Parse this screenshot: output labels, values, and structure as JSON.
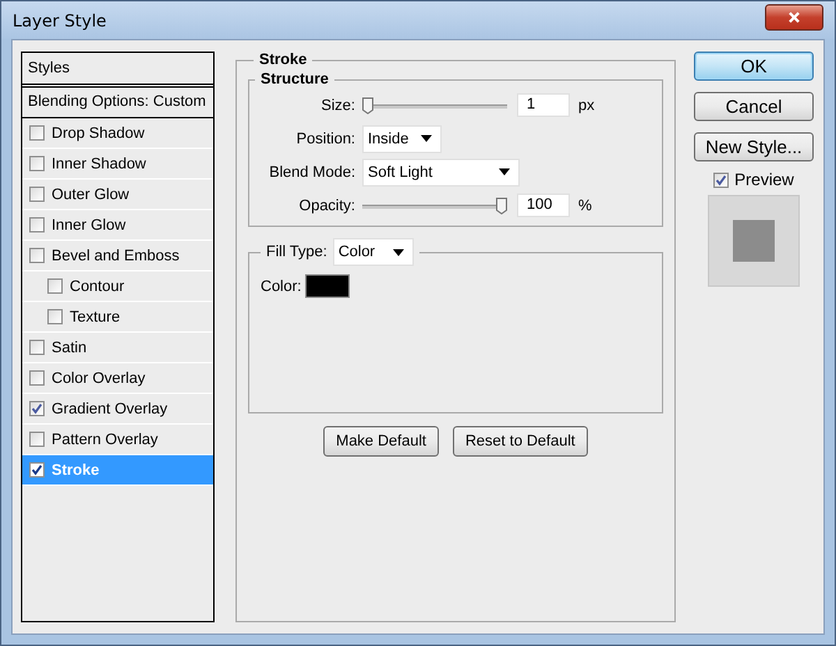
{
  "window": {
    "title": "Layer Style"
  },
  "sidebar": {
    "header": "Styles",
    "blending": "Blending Options: Custom",
    "items": [
      {
        "label": "Drop Shadow",
        "checked": false,
        "selected": false
      },
      {
        "label": "Inner Shadow",
        "checked": false,
        "selected": false
      },
      {
        "label": "Outer Glow",
        "checked": false,
        "selected": false
      },
      {
        "label": "Inner Glow",
        "checked": false,
        "selected": false
      },
      {
        "label": "Bevel and Emboss",
        "checked": false,
        "selected": false,
        "children": [
          {
            "label": "Contour",
            "checked": false,
            "selected": false
          },
          {
            "label": "Texture",
            "checked": false,
            "selected": false
          }
        ]
      },
      {
        "label": "Satin",
        "checked": false,
        "selected": false
      },
      {
        "label": "Color Overlay",
        "checked": false,
        "selected": false
      },
      {
        "label": "Gradient Overlay",
        "checked": true,
        "selected": false
      },
      {
        "label": "Pattern Overlay",
        "checked": false,
        "selected": false
      },
      {
        "label": "Stroke",
        "checked": true,
        "selected": true
      }
    ]
  },
  "stroke": {
    "title": "Stroke",
    "structure": {
      "title": "Structure",
      "size": {
        "label": "Size:",
        "level": 0.0,
        "value": "1",
        "unit": "px"
      },
      "position": {
        "label": "Position:",
        "value": "Inside"
      },
      "blend_mode": {
        "label": "Blend Mode:",
        "value": "Soft Light"
      },
      "opacity": {
        "label": "Opacity:",
        "level": 1.0,
        "value": "100",
        "unit": "%"
      }
    },
    "fill_type": {
      "label": "Fill Type:",
      "value": "Color"
    },
    "color": {
      "label": "Color:",
      "color": "#000000"
    },
    "buttons": [
      "Make Default",
      "Reset to Default"
    ]
  },
  "buttons": [
    {
      "label": "OK",
      "default": true
    },
    {
      "label": "Cancel",
      "default": false
    },
    {
      "label": "New Style...",
      "default": false
    }
  ],
  "preview": {
    "label": "Preview",
    "checked": true
  }
}
